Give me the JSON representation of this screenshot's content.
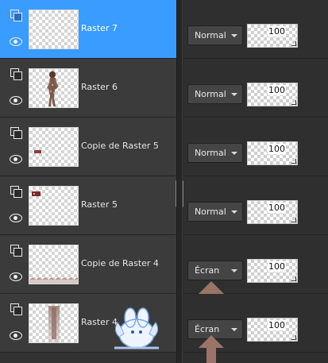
{
  "layers": [
    {
      "name": "Raster 7",
      "selected": true,
      "blend_mode": "Normal",
      "opacity": "100"
    },
    {
      "name": "Raster 6",
      "selected": false,
      "blend_mode": "Normal",
      "opacity": "100"
    },
    {
      "name": "Copie de Raster 5",
      "selected": false,
      "blend_mode": "Normal",
      "opacity": "100"
    },
    {
      "name": "Raster 5",
      "selected": false,
      "blend_mode": "Normal",
      "opacity": "100"
    },
    {
      "name": "Copie de Raster 4",
      "selected": false,
      "blend_mode": "Écran",
      "opacity": "100"
    },
    {
      "name": "Raster 4",
      "selected": false,
      "blend_mode": "Écran",
      "opacity": "100"
    }
  ],
  "annotations": {
    "arrow_color": "#9a7468"
  },
  "colors": {
    "selection": "#3a9cff",
    "panel_bg": "#3b3b3b"
  }
}
